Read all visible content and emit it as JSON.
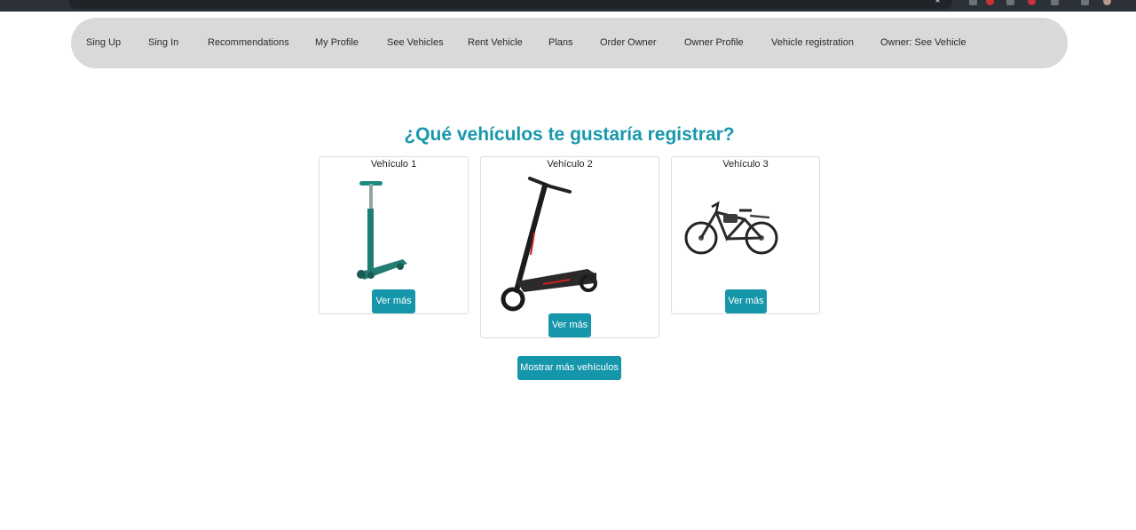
{
  "nav": {
    "items": [
      {
        "label": "Sing Up"
      },
      {
        "label": "Sing In"
      },
      {
        "label": "Recommendations"
      },
      {
        "label": "My Profile"
      },
      {
        "label": "See Vehicles"
      },
      {
        "label": "Rent Vehicle"
      },
      {
        "label": "Plans"
      },
      {
        "label": "Order Owner"
      },
      {
        "label": "Owner Profile"
      },
      {
        "label": "Vehicle registration"
      },
      {
        "label": "Owner: See Vehicle"
      }
    ]
  },
  "main": {
    "heading": "¿Qué vehículos te gustaría registrar?",
    "cards": [
      {
        "title": "Vehículo 1",
        "button": "Ver más",
        "image": "kick-scooter"
      },
      {
        "title": "Vehículo 2",
        "button": "Ver más",
        "image": "electric-scooter"
      },
      {
        "title": "Vehículo 3",
        "button": "Ver más",
        "image": "electric-bicycle"
      }
    ],
    "more_button": "Mostrar más vehículos"
  },
  "colors": {
    "accent": "#1596ab",
    "heading": "#1798ab",
    "nav_background": "#d9d9d9"
  }
}
